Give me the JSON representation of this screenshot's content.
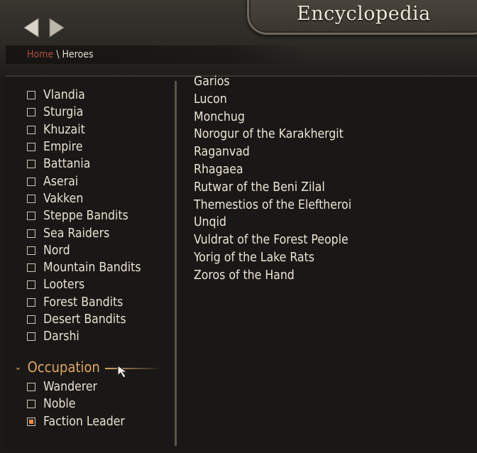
{
  "header": {
    "title": "Encyclopedia",
    "breadcrumb": {
      "home": "Home",
      "separator": " \\ ",
      "current": "Heroes"
    }
  },
  "filters": {
    "factions": [
      {
        "label": "Vlandia",
        "checked": false
      },
      {
        "label": "Sturgia",
        "checked": false
      },
      {
        "label": "Khuzait",
        "checked": false
      },
      {
        "label": "Empire",
        "checked": false
      },
      {
        "label": "Battania",
        "checked": false
      },
      {
        "label": "Aserai",
        "checked": false
      },
      {
        "label": "Vakken",
        "checked": false
      },
      {
        "label": "Steppe Bandits",
        "checked": false
      },
      {
        "label": "Sea Raiders",
        "checked": false
      },
      {
        "label": "Nord",
        "checked": false
      },
      {
        "label": "Mountain Bandits",
        "checked": false
      },
      {
        "label": "Looters",
        "checked": false
      },
      {
        "label": "Forest Bandits",
        "checked": false
      },
      {
        "label": "Desert Bandits",
        "checked": false
      },
      {
        "label": "Darshi",
        "checked": false
      }
    ],
    "occupation": {
      "title": "Occupation",
      "items": [
        {
          "label": "Wanderer",
          "checked": false
        },
        {
          "label": "Noble",
          "checked": false
        },
        {
          "label": "Faction Leader",
          "checked": true
        }
      ]
    }
  },
  "heroes": [
    "Garios",
    "Lucon",
    "Monchug",
    "Norogur of the Karakhergit",
    "Raganvad",
    "Rhagaea",
    "Rutwar of the Beni Zilal",
    "Themestios of the Eleftheroi",
    "Unqid",
    "Vuldrat of the Forest People",
    "Yorig of the Lake Rats",
    "Zoros of the Hand"
  ],
  "colors": {
    "accent": "#e0a860",
    "checkbox_fill": "#f08a44",
    "breadcrumb_home": "#b3503f"
  }
}
